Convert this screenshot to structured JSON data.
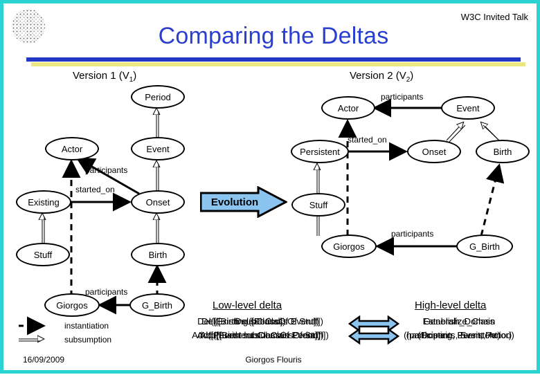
{
  "slide": {
    "talk_label": "W3C Invited Talk",
    "title": "Comparing the Deltas",
    "date": "16/09/2009",
    "author": "Giorgos Flouris",
    "accent_border": "#2ad2d2",
    "rule_blue": "#2337c6",
    "rule_yellow": "#ece87f",
    "title_color": "#2a3fd0"
  },
  "versions": {
    "v1_head": "Version 1 (V",
    "v1_sub": "1",
    "v1_tail": ")",
    "v2_head": "Version 2 (V",
    "v2_sub": "2",
    "v2_tail": ")"
  },
  "v1": {
    "nodes": [
      {
        "id": "period",
        "label": "Period"
      },
      {
        "id": "actor",
        "label": "Actor"
      },
      {
        "id": "event",
        "label": "Event"
      },
      {
        "id": "existing",
        "label": "Existing"
      },
      {
        "id": "onset",
        "label": "Onset"
      },
      {
        "id": "stuff",
        "label": "Stuff"
      },
      {
        "id": "birth",
        "label": "Birth"
      },
      {
        "id": "giorgos",
        "label": "Giorgos"
      },
      {
        "id": "gbirth",
        "label": "G_Birth"
      }
    ],
    "labels": {
      "participants_top": "participants",
      "started_on": "started_on",
      "participants_bottom": "participants"
    }
  },
  "v2": {
    "nodes": [
      {
        "id": "actor",
        "label": "Actor"
      },
      {
        "id": "event",
        "label": "Event"
      },
      {
        "id": "persistent",
        "label": "Persistent"
      },
      {
        "id": "onset",
        "label": "Onset"
      },
      {
        "id": "birth",
        "label": "Birth"
      },
      {
        "id": "stuff",
        "label": "Stuff"
      },
      {
        "id": "giorgos",
        "label": "Giorgos"
      },
      {
        "id": "gbirth",
        "label": "G_Birth"
      }
    ],
    "labels": {
      "participants_top": "participants",
      "started_on": "started_on",
      "participants_bottom": "participants"
    }
  },
  "evolution": {
    "label": "Evolution",
    "fill": "#8cc4f0"
  },
  "delta": {
    "low_level_heading": "Low-level delta",
    "high_level_heading": "High-level delta",
    "low_level_lines": [
      "Del([Period])",
      "Del([Existing subClassOf Stuff])",
      "Del([Birth subClassOf Event])",
      "Add([Persistent subClassOf Stuff])",
      "Add([Birth subClassOf Event])",
      "Add([Event hasDomain Period])"
    ],
    "high_level_lines": [
      "Generalize_Class",
      "Establish_Domain",
      "(Existing, Persistent)",
      "(participants, Event, Actor)",
      "(hasDomain, Event, Period)"
    ],
    "arrow_fill": "#8cc4f0"
  },
  "legend": {
    "instantiation": "instantiation",
    "subsumption": "subsumption"
  }
}
